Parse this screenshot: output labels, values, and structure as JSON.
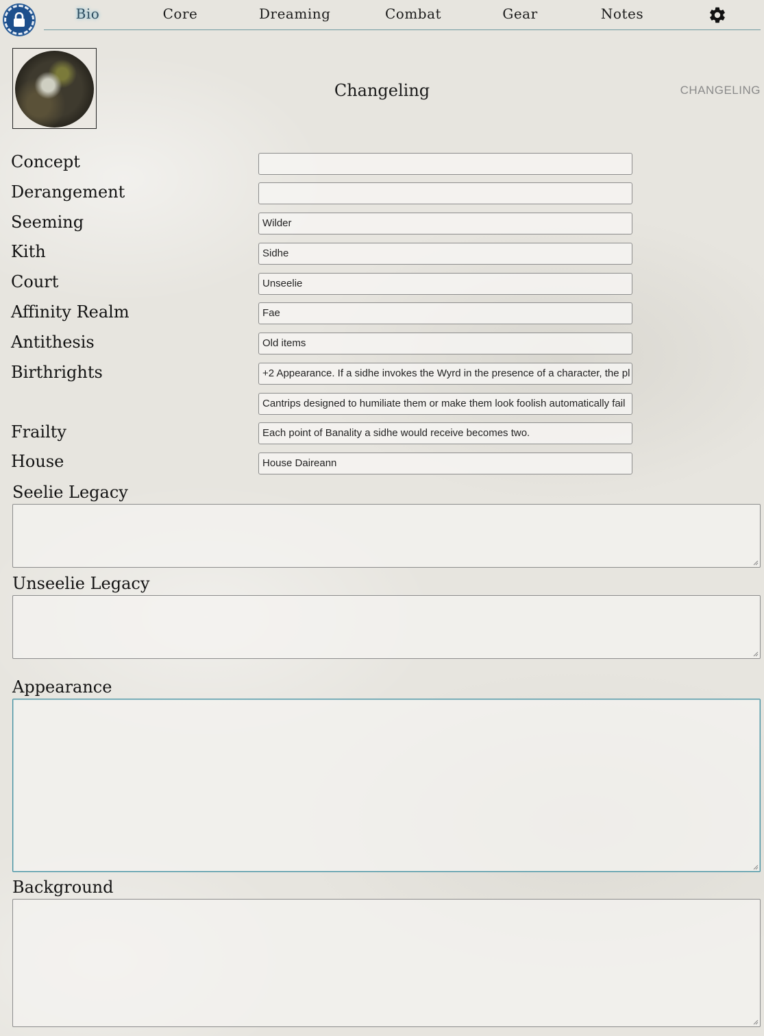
{
  "nav": {
    "tabs": [
      {
        "label": "Bio",
        "active": true
      },
      {
        "label": "Core"
      },
      {
        "label": "Dreaming"
      },
      {
        "label": "Combat"
      },
      {
        "label": "Gear"
      },
      {
        "label": "Notes"
      }
    ],
    "lock_icon": "lock-icon",
    "settings_icon": "gear-icon",
    "accent_color": "#1d4f8c"
  },
  "header": {
    "title": "Changeling",
    "sheet_type": "CHANGELING",
    "portrait_icon": "character-portrait"
  },
  "fields": [
    {
      "label": "Concept",
      "value": ""
    },
    {
      "label": "Derangement",
      "value": ""
    },
    {
      "label": "Seeming",
      "value": "Wilder"
    },
    {
      "label": "Kith",
      "value": "Sidhe"
    },
    {
      "label": "Court",
      "value": "Unseelie"
    },
    {
      "label": "Affinity Realm",
      "value": "Fae"
    },
    {
      "label": "Antithesis",
      "value": "Old items"
    },
    {
      "label": "Birthrights",
      "value": "+2 Appearance. If a sidhe invokes the Wyrd in the presence of a character, the pl"
    },
    {
      "label": "",
      "value": "Cantrips designed to humiliate them or make them look foolish automatically fail"
    },
    {
      "label": "Frailty",
      "value": "Each point of Banality a sidhe would receive becomes two."
    },
    {
      "label": "House",
      "value": "House Daireann"
    }
  ],
  "text_areas": [
    {
      "label": "Seelie Legacy",
      "value": ""
    },
    {
      "label": "Unseelie Legacy",
      "value": ""
    },
    {
      "label": "Appearance",
      "value": ""
    },
    {
      "label": "Background",
      "value": ""
    }
  ]
}
